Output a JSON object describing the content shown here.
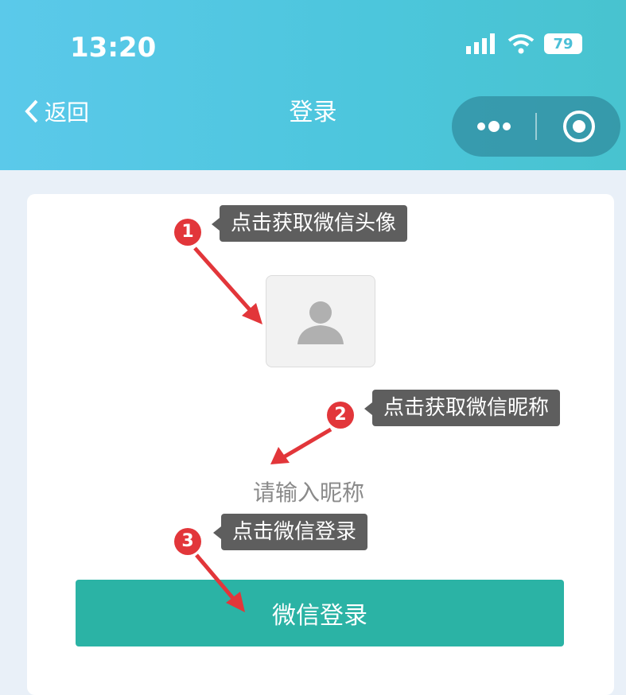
{
  "status_bar": {
    "time": "13:20",
    "battery": "79"
  },
  "nav": {
    "back_label": "返回",
    "title": "登录"
  },
  "steps": [
    {
      "number": "1",
      "tip": "点击获取微信头像"
    },
    {
      "number": "2",
      "tip": "点击获取微信昵称"
    },
    {
      "number": "3",
      "tip": "点击微信登录"
    }
  ],
  "form": {
    "nickname_placeholder": "请输入昵称",
    "login_button": "微信登录"
  },
  "colors": {
    "header": "#4cc6dc",
    "button": "#2bb3a5",
    "badge": "#e2363a",
    "tooltip": "#5e5e5e"
  }
}
